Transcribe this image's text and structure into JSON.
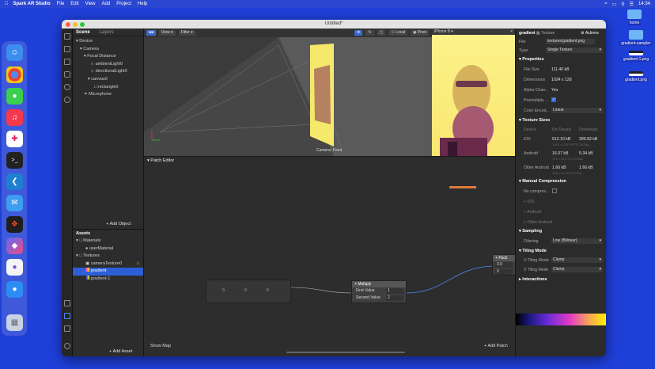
{
  "menubar": {
    "app_name": "Spark AR Studio",
    "items": [
      "File",
      "Edit",
      "View",
      "Add",
      "Project",
      "Help"
    ],
    "time": "14:34"
  },
  "desktop": {
    "icons": [
      {
        "label": "home"
      },
      {
        "label": "gradient-sampler"
      },
      {
        "label": "gradient-1.png"
      },
      {
        "label": "gradient.png"
      }
    ]
  },
  "window": {
    "title": "Untitled*"
  },
  "scene_panel": {
    "tabs": [
      "Scene",
      "Layers"
    ],
    "tree": [
      {
        "label": "Device",
        "level": 0
      },
      {
        "label": "Camera",
        "level": 1
      },
      {
        "label": "Focal Distance",
        "level": 2
      },
      {
        "label": "ambientLight0",
        "level": 3
      },
      {
        "label": "directionalLight0",
        "level": 3
      },
      {
        "label": "canvas0",
        "level": 3
      },
      {
        "label": "rectangle0",
        "level": 4
      },
      {
        "label": "Microphone",
        "level": 1
      }
    ],
    "add_object": "Add Object"
  },
  "assets_panel": {
    "title": "Assets",
    "tree": [
      {
        "label": "Materials",
        "level": 0
      },
      {
        "label": "userMaterial",
        "level": 1
      },
      {
        "label": "Textures",
        "level": 0
      },
      {
        "label": "cameraTexture0",
        "level": 1
      },
      {
        "label": "gradient",
        "level": 1,
        "selected": true
      },
      {
        "label": "gradient-1",
        "level": 1
      }
    ],
    "add_asset": "Add Asset"
  },
  "viewport": {
    "view_label": "View",
    "filter_label": "Filter",
    "local_label": "Local",
    "pivot_label": "Pivot",
    "camera_caption": "Camera: Front"
  },
  "simulator": {
    "device": "iPhone 8"
  },
  "patch_editor": {
    "title": "Patch Editor",
    "show_map": "Show Map",
    "add_patch": "Add Patch",
    "nodes": {
      "multiply": {
        "title": "Multiply",
        "first_label": "First Value",
        "first_value": "1",
        "second_label": "Second Value",
        "second_value": "2"
      },
      "pack": {
        "title": "Pack",
        "value1": "0.0",
        "value2": "0"
      },
      "vector_values": [
        "0",
        "0",
        "0"
      ]
    }
  },
  "inspector": {
    "title": "gradient",
    "subtitle": "Texture",
    "actions": "Actions",
    "file_label": "File",
    "file_value": "textures/gradient.png",
    "type_label": "Type",
    "type_value": "Single Texture",
    "properties_title": "Properties",
    "file_size_label": "File Size",
    "file_size_value": "111.40 kB",
    "dimensions_label": "Dimensions",
    "dimensions_value": "1024 x 128",
    "alpha_label": "Alpha Chan...",
    "alpha_value": "Yes",
    "premultiply_label": "Premultiply ...",
    "color_label": "Color Encod...",
    "color_value": "Linear",
    "texture_sizes_title": "Texture Sizes",
    "ts_headers": [
      "Device",
      "On Device",
      "Download"
    ],
    "ts_rows": [
      {
        "device": "iOS",
        "on_device": "512.10 kB",
        "download": "289.82 kB",
        "sub": "1024 x 128 PVRTC RGBA"
      },
      {
        "device": "Android",
        "on_device": "16.07 kB",
        "download": "5.34 kB",
        "sub": "128 x 16 ETC2 RGBA"
      },
      {
        "device": "Older Android",
        "on_device": "1.66 kB",
        "download": "1.66 kB",
        "sub": "128 x 16 PNG RGBA"
      }
    ],
    "manual_compression_title": "Manual Compression",
    "no_compress": "No compres...",
    "mc_rows": [
      "iOS",
      "Android",
      "Older Android"
    ],
    "sampling_title": "Sampling",
    "filtering_label": "Filtering",
    "filtering_value": "Low (Bilinear)",
    "tiling_title": "Tiling Mode",
    "u_label": "U Tiling Mode",
    "u_value": "Clamp",
    "v_label": "V Tiling Mode",
    "v_value": "Clamp",
    "interactions_title": "Interactions"
  }
}
